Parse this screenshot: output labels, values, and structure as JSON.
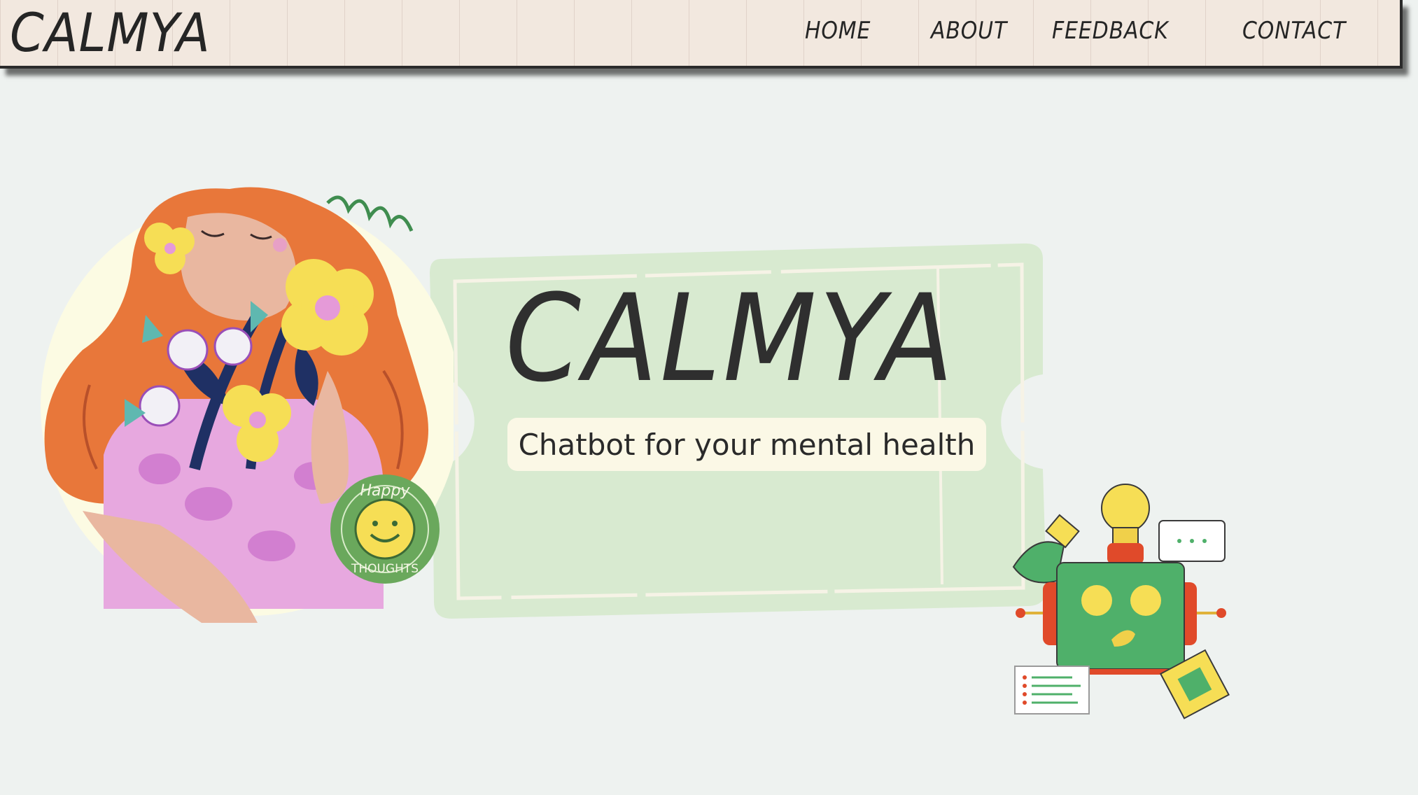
{
  "brand": {
    "name": "CALMYA"
  },
  "nav": {
    "items": [
      {
        "label": "HOME"
      },
      {
        "label": "ABOUT"
      },
      {
        "label": "FEEDBACK"
      },
      {
        "label": "CONTACT"
      }
    ]
  },
  "hero": {
    "title": "CALMYA",
    "subtitle": "Chatbot for your mental health"
  },
  "sticker": {
    "top_text": "Happy",
    "bottom_text": "THOUGHTS"
  },
  "colors": {
    "page_bg": "#eef2f0",
    "nav_bg": "#f2e8df",
    "ticket": "#d8ead0",
    "subtitle_bg": "#fbf8e6",
    "hair": "#e8773a",
    "robot_green": "#4fb06a",
    "robot_red": "#e04a2a",
    "flower_yellow": "#f6de55"
  }
}
